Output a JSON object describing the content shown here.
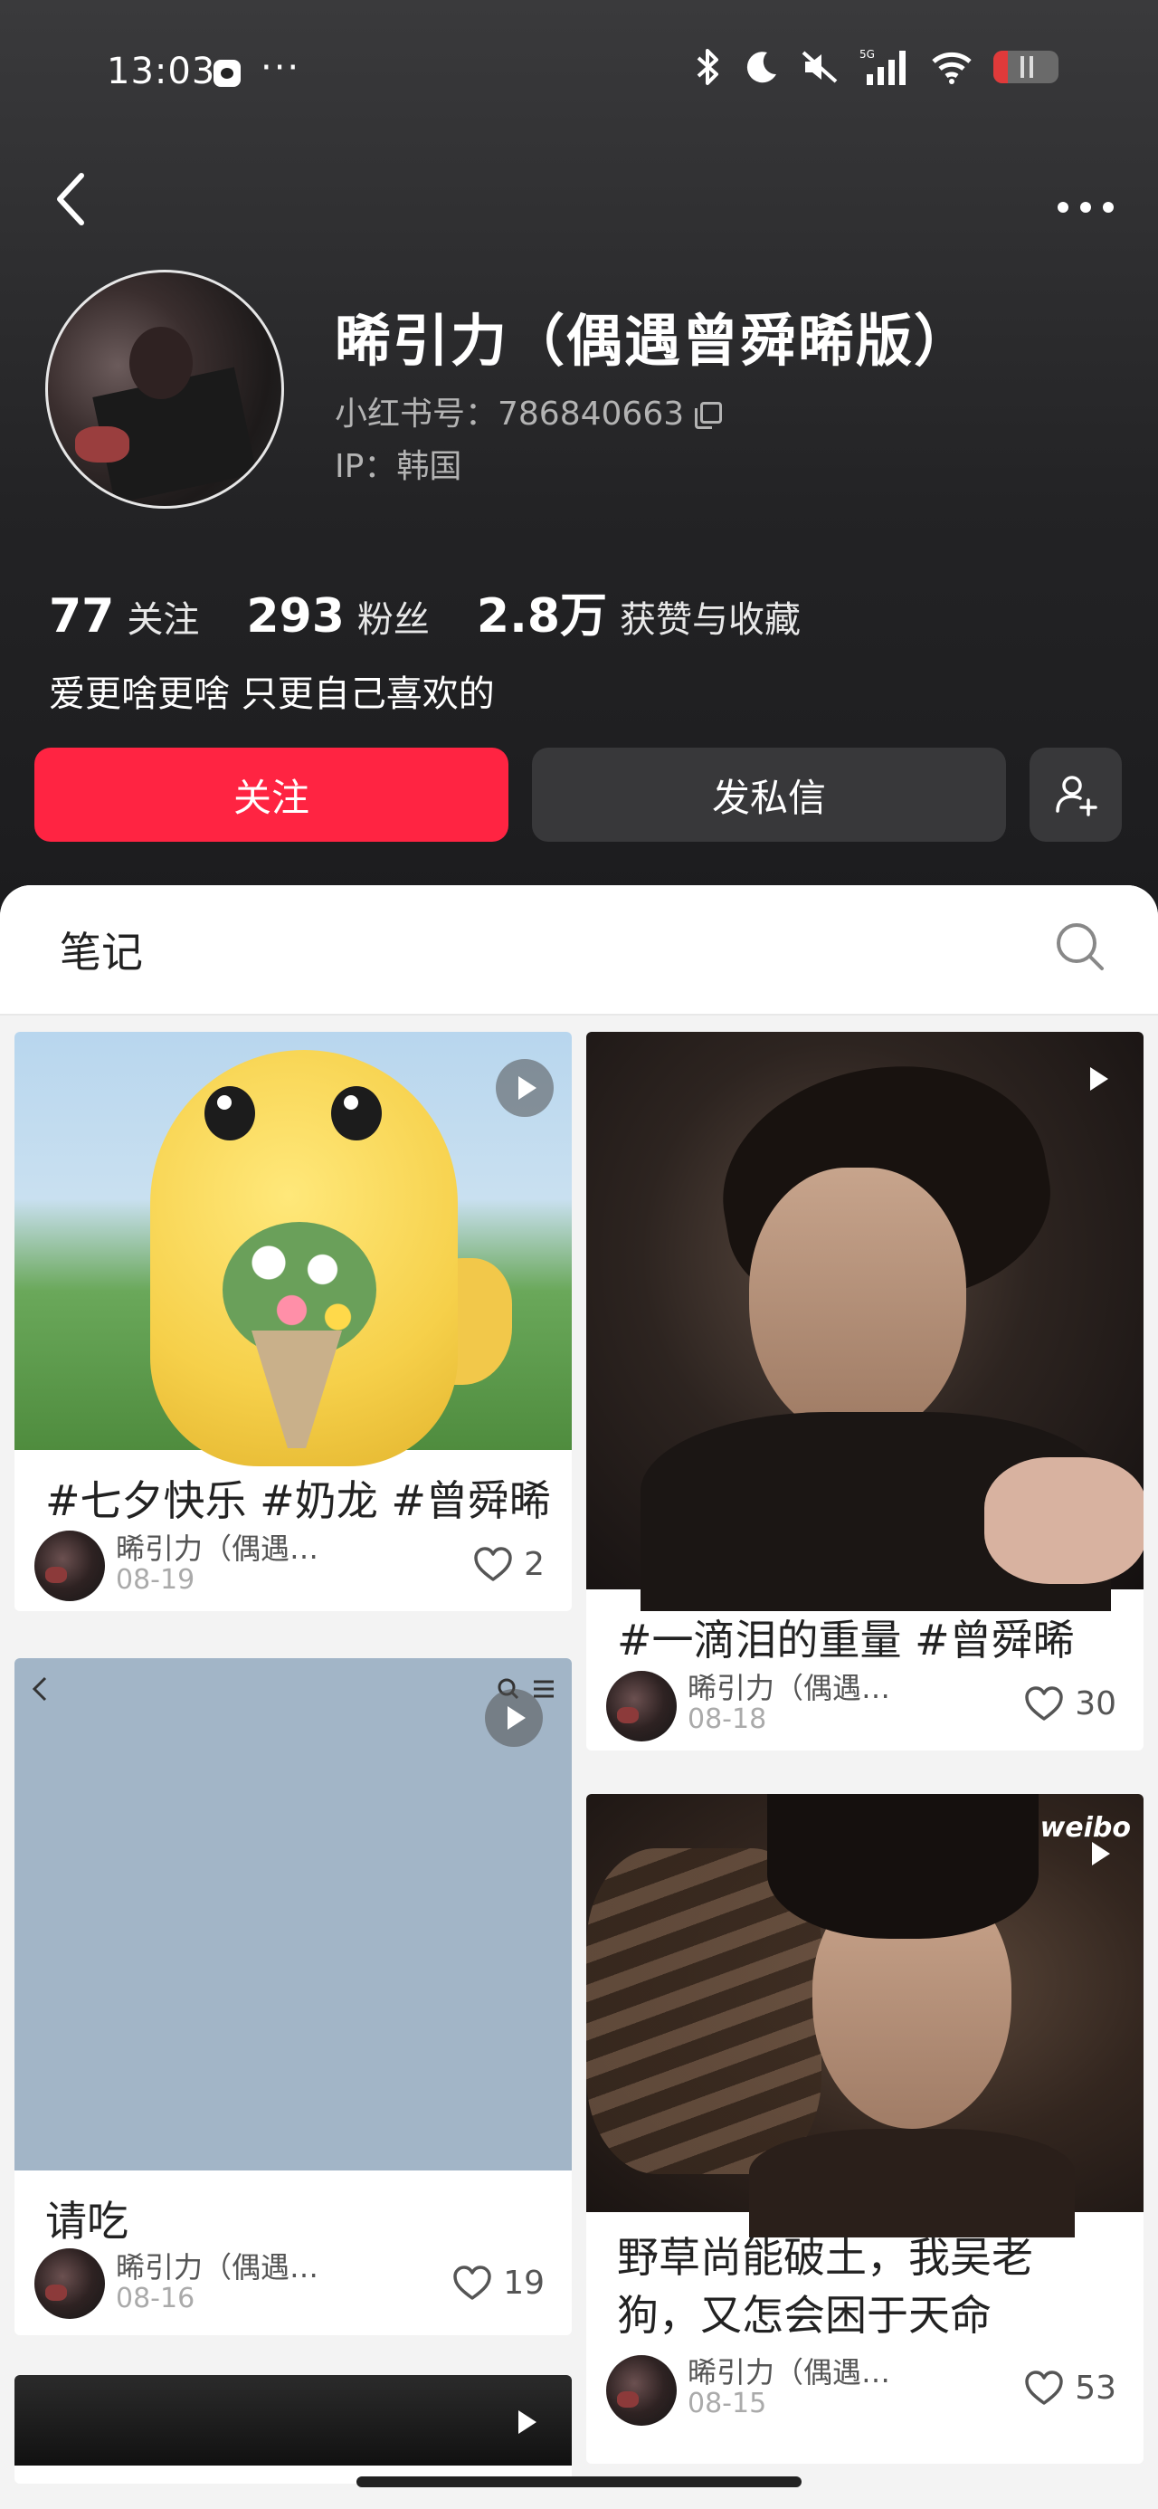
{
  "status_bar": {
    "time": "13:03",
    "dots": "···",
    "network": "5G",
    "icons": [
      "bluetooth-icon",
      "moon-icon",
      "mute-icon",
      "signal-icon",
      "wifi-icon",
      "battery-icon"
    ],
    "battery_level": 0.22
  },
  "profile": {
    "name": "晞引力（偶遇曾舜晞版）",
    "id_label": "小红书号：786840663",
    "ip_label": "IP：韩国",
    "stats": [
      {
        "num": "77",
        "label": "关注"
      },
      {
        "num": "293",
        "label": "粉丝"
      },
      {
        "num": "2.8万",
        "label": "获赞与收藏"
      }
    ],
    "bio": "爱更啥更啥 只更自己喜欢的",
    "follow_label": "关注",
    "message_label": "发私信"
  },
  "tabs": {
    "notes_label": "笔记"
  },
  "notes": [
    {
      "title": "#七夕快乐 #奶龙 #曾舜晞",
      "author": "晞引力（偶遇…",
      "date": "08-19",
      "likes": "2"
    },
    {
      "title": "#一滴泪的重量 #曾舜晞",
      "author": "晞引力（偶遇…",
      "date": "08-18",
      "likes": "30"
    },
    {
      "title": "请吃",
      "author": "晞引力（偶遇…",
      "date": "08-16",
      "likes": "19"
    },
    {
      "title_line1": "野草尚能破土，我吴老",
      "title_line2": "狗，又怎会困于天命",
      "author": "晞引力（偶遇…",
      "date": "08-15",
      "likes": "53",
      "watermark": "weibo"
    }
  ],
  "colors": {
    "accent": "#ff2442",
    "header_bg": "#1c1c1e",
    "secondary_button": "#38383a"
  }
}
